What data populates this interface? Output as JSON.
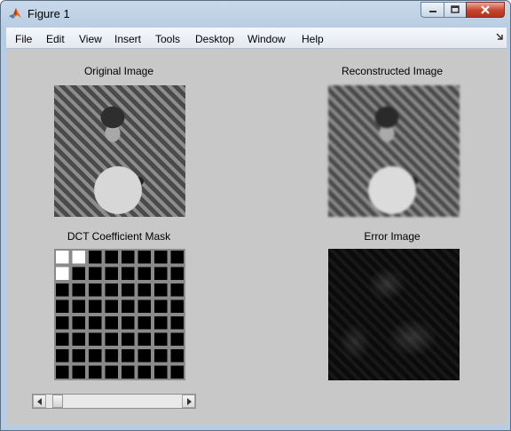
{
  "window": {
    "title": "Figure 1",
    "icon": "matlab-logo-icon",
    "controls": [
      "minimize-icon",
      "maximize-icon",
      "close-icon"
    ]
  },
  "menubar": {
    "items": [
      "File",
      "Edit",
      "View",
      "Insert",
      "Tools",
      "Desktop",
      "Window",
      "Help"
    ],
    "overflow_icon": "dock-arrow-icon"
  },
  "figure": {
    "background": "#c8c8c8",
    "axes": {
      "original": {
        "title": "Original Image"
      },
      "reconstructed": {
        "title": "Reconstructed Image"
      },
      "mask": {
        "title": "DCT Coefficient Mask",
        "grid_size": 8,
        "selected_cells": [
          [
            0,
            0
          ],
          [
            0,
            1
          ],
          [
            1,
            0
          ]
        ]
      },
      "error": {
        "title": "Error Image"
      }
    },
    "slider": {
      "value_fraction": 0.05,
      "left_icon": "arrow-left-icon",
      "right_icon": "arrow-right-icon"
    }
  }
}
